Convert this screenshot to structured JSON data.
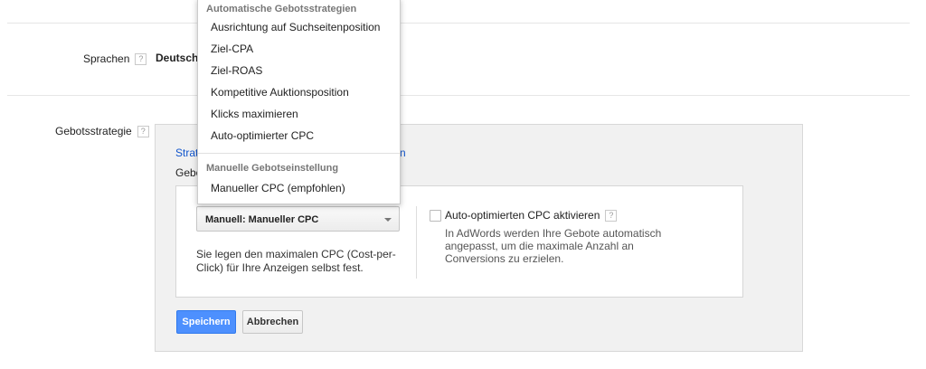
{
  "settings": {
    "languages": {
      "label": "Sprachen",
      "value": "Deutsch"
    },
    "bid_strategy": {
      "label": "Gebotsstrategie"
    }
  },
  "help_glyph": "?",
  "panel": {
    "link_text": "Strat",
    "link_suffix": "n",
    "prefix_text": "Gebo",
    "select_value": "Manuell: Manueller CPC",
    "description": "Sie legen den maximalen CPC (Cost-per-Click) für Ihre Anzeigen selbst fest.",
    "checkbox": {
      "label": "Auto-optimierten CPC aktivieren",
      "checked": false,
      "description": "In AdWords werden Ihre Gebote automatisch angepasst, um die maximale Anzahl an Conversions zu erzielen."
    },
    "buttons": {
      "save": "Speichern",
      "cancel": "Abbrechen"
    }
  },
  "dropdown": {
    "group_auto": "Automatische Gebotsstrategien",
    "auto_items": [
      "Ausrichtung auf Suchseitenposition",
      "Ziel-CPA",
      "Ziel-ROAS",
      "Kompetitive Auktionsposition",
      "Klicks maximieren",
      "Auto-optimierter CPC"
    ],
    "group_manual": "Manuelle Gebotseinstellung",
    "manual_items": [
      "Manueller CPC (empfohlen)"
    ]
  },
  "colors": {
    "primary": "#4d90fe",
    "link": "#1155cc",
    "panel_bg": "#f1f1f1"
  }
}
